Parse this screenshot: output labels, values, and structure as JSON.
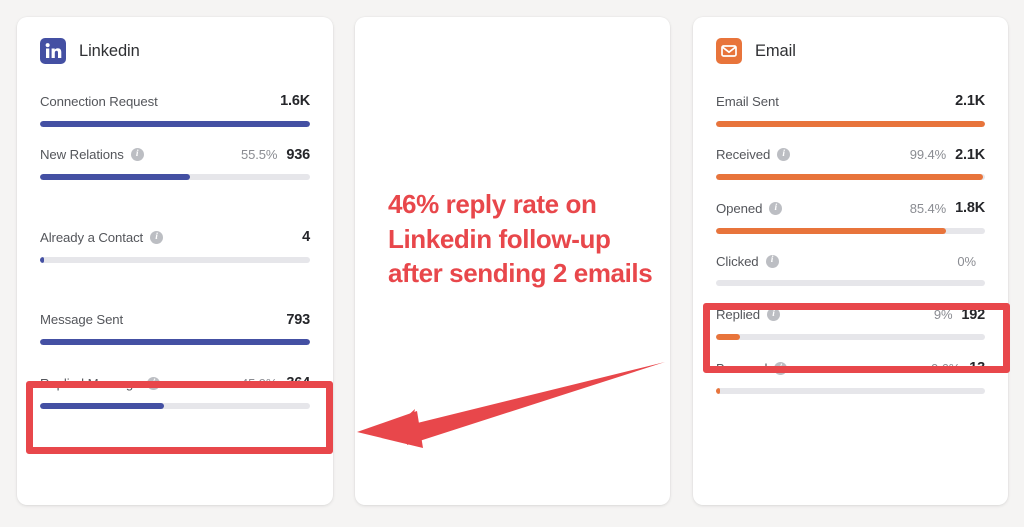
{
  "theme": {
    "page_background": "#f5f4f3",
    "card_background": "#ffffff",
    "linkedin_color": "#4450a3",
    "email_color": "#e8743b",
    "highlight_color": "#e8474b",
    "track_color": "#e6e6ea"
  },
  "linkedin_card": {
    "icon": "linkedin-icon",
    "title": "Linkedin",
    "metrics": [
      {
        "label": "Connection Request",
        "has_info": false,
        "pct_text": "",
        "value": "1.6K",
        "fill_pct": 100
      },
      {
        "label": "New Relations",
        "has_info": true,
        "pct_text": "55.5%",
        "value": "936",
        "fill_pct": 55.5
      },
      {
        "label": "Already a Contact",
        "has_info": true,
        "pct_text": "",
        "value": "4",
        "fill_pct": 1.5
      },
      {
        "label": "Message Sent",
        "has_info": false,
        "pct_text": "",
        "value": "793",
        "fill_pct": 100
      },
      {
        "label": "Replied Message",
        "has_info": true,
        "pct_text": "45.9%",
        "value": "364",
        "fill_pct": 45.9
      }
    ]
  },
  "note_card": {
    "text": "46% reply rate on Linkedin follow-up after sending 2 emails",
    "arrow": "left-pointing-arrow"
  },
  "email_card": {
    "icon": "email-icon",
    "title": "Email",
    "metrics": [
      {
        "label": "Email Sent",
        "has_info": false,
        "pct_text": "",
        "value": "2.1K",
        "fill_pct": 100
      },
      {
        "label": "Received",
        "has_info": true,
        "pct_text": "99.4%",
        "value": "2.1K",
        "fill_pct": 99.4
      },
      {
        "label": "Opened",
        "has_info": true,
        "pct_text": "85.4%",
        "value": "1.8K",
        "fill_pct": 85.4
      },
      {
        "label": "Clicked",
        "has_info": true,
        "pct_text": "0%",
        "value": "",
        "fill_pct": 0
      },
      {
        "label": "Replied",
        "has_info": true,
        "pct_text": "9%",
        "value": "192",
        "fill_pct": 9
      },
      {
        "label": "Bounced",
        "has_info": true,
        "pct_text": "0.6%",
        "value": "13",
        "fill_pct": 1.6
      }
    ]
  },
  "info_glyph": "i"
}
